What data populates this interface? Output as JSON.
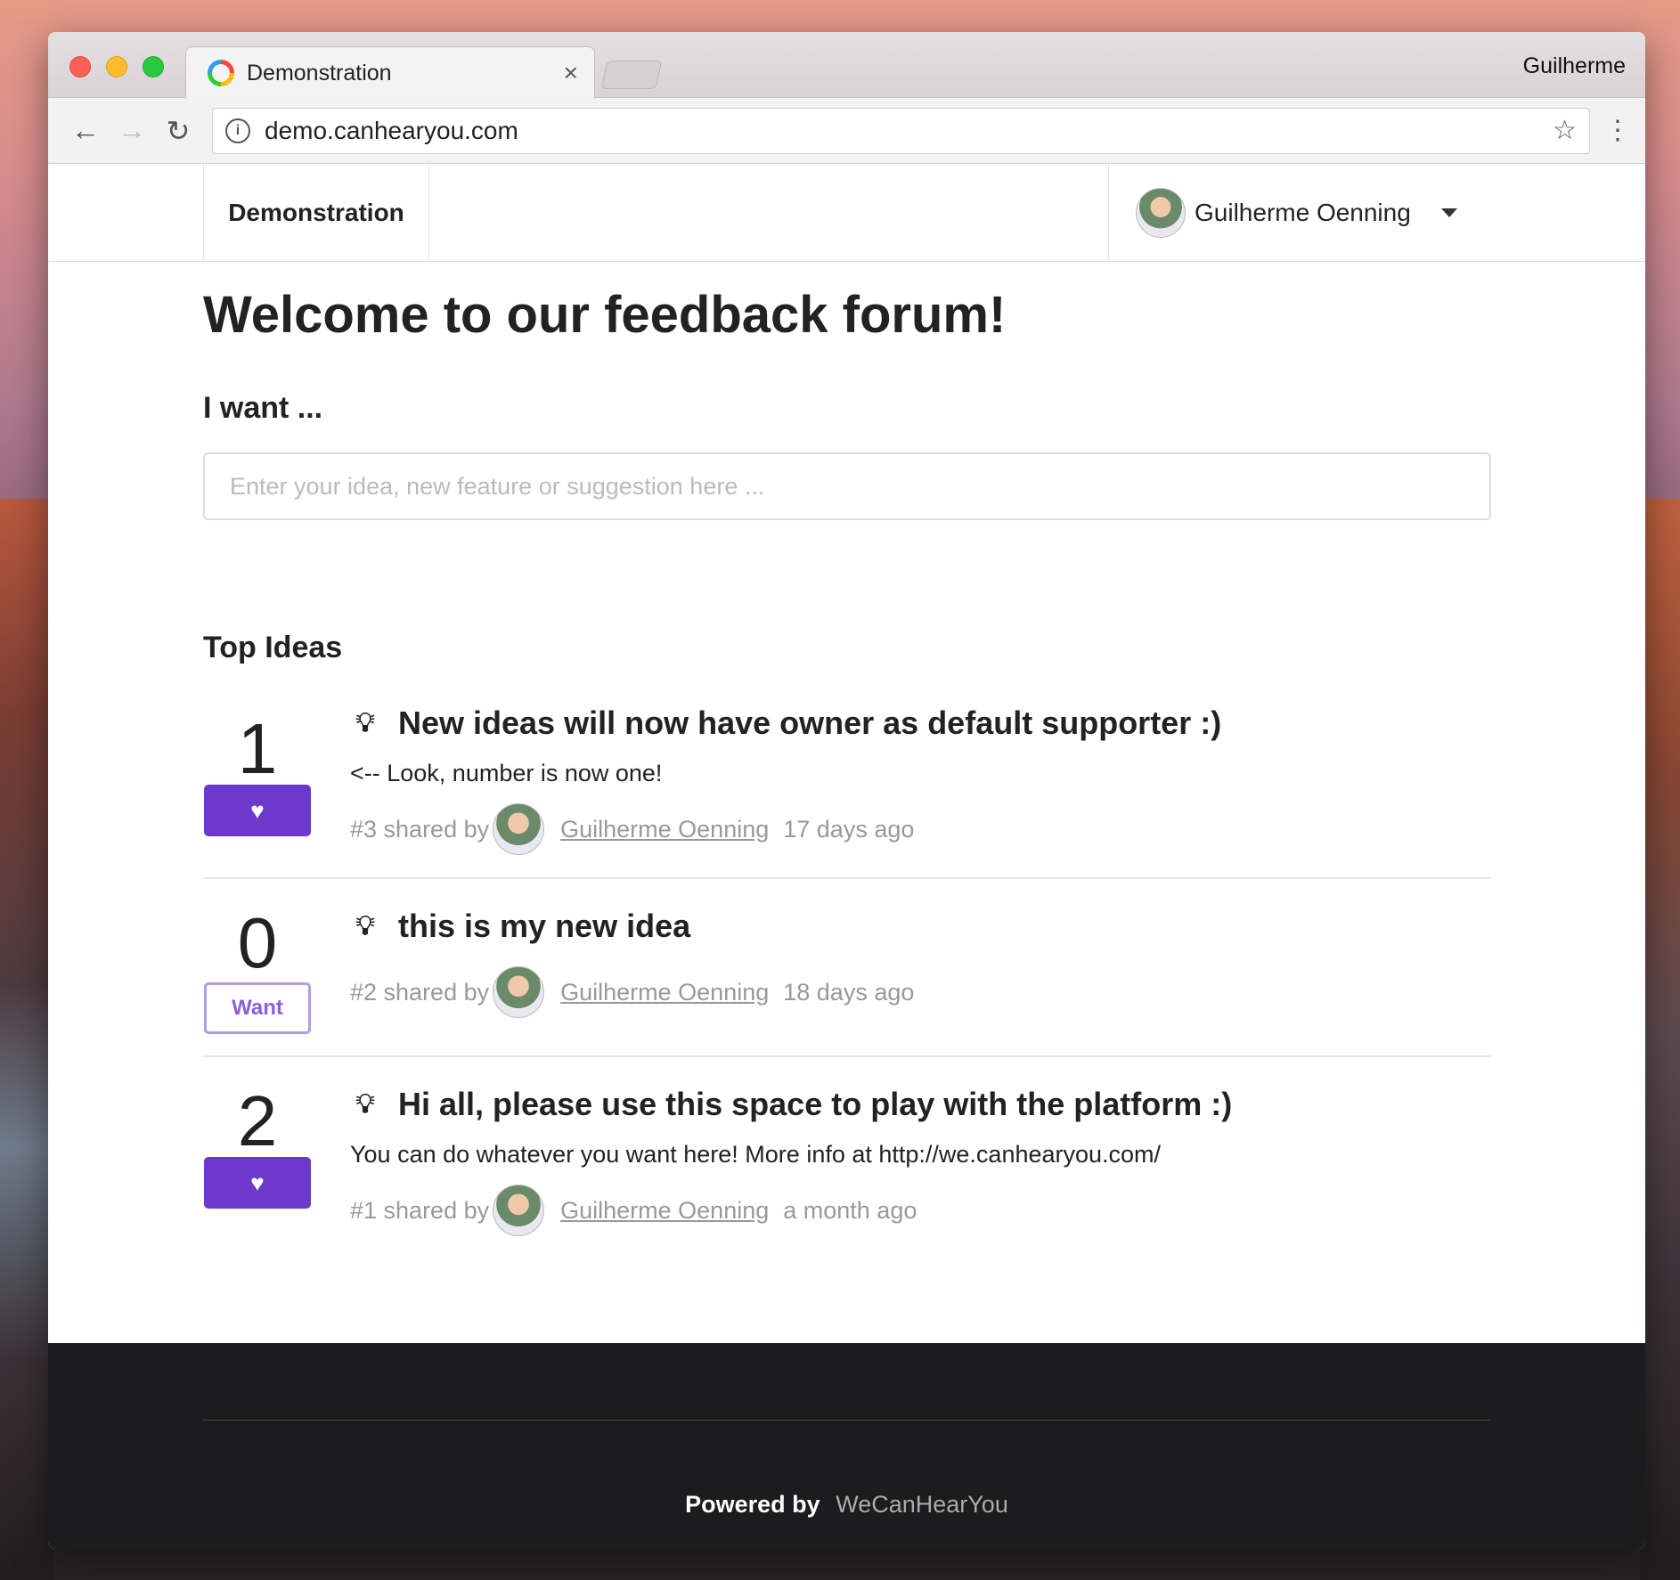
{
  "browser": {
    "tab_title": "Demonstration",
    "tab_close": "×",
    "profile": "Guilherme",
    "url": "demo.canhearyou.com",
    "back": "←",
    "forward": "→",
    "reload": "↻",
    "star": "☆",
    "menu": "⋮",
    "info": "i"
  },
  "site": {
    "brand": "Demonstration",
    "user_name": "Guilherme Oenning"
  },
  "main": {
    "welcome": "Welcome to our feedback forum!",
    "i_want": "I want ...",
    "input_placeholder": "Enter your idea, new feature or suggestion here ...",
    "top_ideas": "Top Ideas"
  },
  "ideas": [
    {
      "votes": "1",
      "supported": true,
      "button": "♥",
      "title": "New ideas will now have owner as default supporter :)",
      "description": "<-- Look, number is now one!",
      "shared": "#3 shared by",
      "author": "Guilherme Oenning",
      "time": "17 days ago"
    },
    {
      "votes": "0",
      "supported": false,
      "button": "Want",
      "title": "this is my new idea",
      "description": "",
      "shared": "#2 shared by",
      "author": "Guilherme Oenning",
      "time": "18 days ago"
    },
    {
      "votes": "2",
      "supported": true,
      "button": "♥",
      "title": "Hi all, please use this space to play with the platform :)",
      "description": "You can do whatever you want here! More info at http://we.canhearyou.com/",
      "shared": "#1 shared by",
      "author": "Guilherme Oenning",
      "time": "a month ago"
    }
  ],
  "footer": {
    "powered_by": "Powered by",
    "brand": "WeCanHearYou"
  },
  "colors": {
    "accent": "#6c39cc",
    "accent_light": "#b59ae8",
    "footer_bg": "#1c1c1e"
  },
  "icons": {
    "bulb": "lightbulb-icon",
    "heart": "heart-icon"
  }
}
